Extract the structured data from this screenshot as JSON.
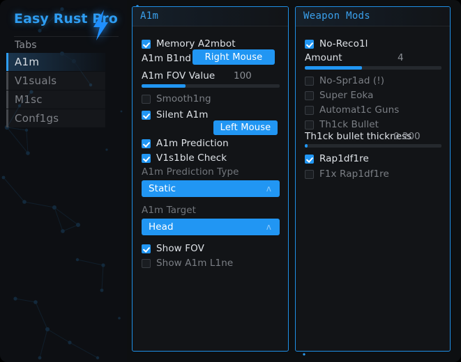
{
  "app": {
    "brand": "Easy Rust Pro",
    "brand_icon": "lightning-bolt-icon",
    "accent_color": "#2196f3",
    "panel_border_color": "#1f8fe6",
    "background_color": "#0d0f11"
  },
  "sidebar": {
    "section_label": "Tabs",
    "items": [
      {
        "label": "A1m",
        "active": true
      },
      {
        "label": "V1suals",
        "active": false
      },
      {
        "label": "M1sc",
        "active": false
      },
      {
        "label": "Conf1gs",
        "active": false
      }
    ]
  },
  "panels": [
    {
      "id": "aim",
      "title": "A1m",
      "controls": [
        {
          "type": "checkbox",
          "label": "Memory A2mbot",
          "checked": true,
          "enabled": true
        },
        {
          "type": "keybind",
          "label": "A1m B1nd",
          "button": "Right Mouse"
        },
        {
          "type": "slider",
          "label": "A1m FOV Value",
          "value": "100",
          "percent": 32
        },
        {
          "type": "checkbox",
          "label": "Smooth1ng",
          "checked": false,
          "enabled": false
        },
        {
          "type": "keybind",
          "label": "Silent A1m",
          "button": "Left Mouse",
          "checkbox": true,
          "checked": true
        },
        {
          "type": "checkbox",
          "label": "A1m Prediction",
          "checked": true,
          "enabled": true
        },
        {
          "type": "checkbox",
          "label": "V1s1ble Check",
          "checked": true,
          "enabled": true
        },
        {
          "type": "dropdown",
          "label": "A1m Prediction Type",
          "value": "Static",
          "arrow": "chevron-up-icon"
        },
        {
          "type": "dropdown",
          "label": "A1m Target",
          "value": "Head",
          "arrow": "chevron-up-icon"
        },
        {
          "type": "checkbox",
          "label": "Show FOV",
          "checked": true,
          "enabled": true
        },
        {
          "type": "checkbox",
          "label": "Show A1m L1ne",
          "checked": false,
          "enabled": false
        }
      ]
    },
    {
      "id": "weapon",
      "title": "Weapon Mods",
      "controls": [
        {
          "type": "checkbox",
          "label": "No-Reco1l",
          "checked": true,
          "enabled": true
        },
        {
          "type": "slider",
          "label": "Amount",
          "value": "4",
          "percent": 42
        },
        {
          "type": "checkbox",
          "label": "No-Spr1ad (!)",
          "checked": false,
          "enabled": false
        },
        {
          "type": "checkbox",
          "label": "Super Eoka",
          "checked": false,
          "enabled": false
        },
        {
          "type": "checkbox",
          "label": "Automat1c Guns",
          "checked": false,
          "enabled": false
        },
        {
          "type": "checkbox",
          "label": "Th1ck Bullet",
          "checked": false,
          "enabled": false
        },
        {
          "type": "slider",
          "label": "Th1ck bullet thickness",
          "value": "0.200",
          "percent": 2
        },
        {
          "type": "checkbox",
          "label": "Rap1df1re",
          "checked": true,
          "enabled": true
        },
        {
          "type": "checkbox",
          "label": "F1x Rap1df1re",
          "checked": false,
          "enabled": false
        }
      ]
    }
  ],
  "aim": {
    "title": "A1m",
    "memory_aimbot": "Memory A2mbot",
    "aim_bind_label": "A1m B1nd",
    "aim_bind_value": "Right Mouse",
    "fov_label": "A1m FOV Value",
    "fov_value": "100",
    "smoothing": "Smooth1ng",
    "silent_aim": "Silent A1m",
    "silent_aim_bind": "Left Mouse",
    "aim_prediction": "A1m Prediction",
    "visible_check": "V1s1ble Check",
    "prediction_type_label": "A1m Prediction Type",
    "prediction_type_value": "Static",
    "target_label": "A1m Target",
    "target_value": "Head",
    "show_fov": "Show FOV",
    "show_aim_line": "Show A1m L1ne",
    "arrow_glyph": "ʌ"
  },
  "weapon": {
    "title": "Weapon Mods",
    "no_recoil": "No-Reco1l",
    "amount_label": "Amount",
    "amount_value": "4",
    "no_spread": "No-Spr1ad (!)",
    "super_eoka": "Super Eoka",
    "automatic_guns": "Automat1c Guns",
    "thick_bullet": "Th1ck Bullet",
    "thickness_label": "Th1ck bullet thickness",
    "thickness_value": "0.200",
    "rapidfire": "Rap1df1re",
    "fix_rapidfire": "F1x Rap1df1re"
  }
}
